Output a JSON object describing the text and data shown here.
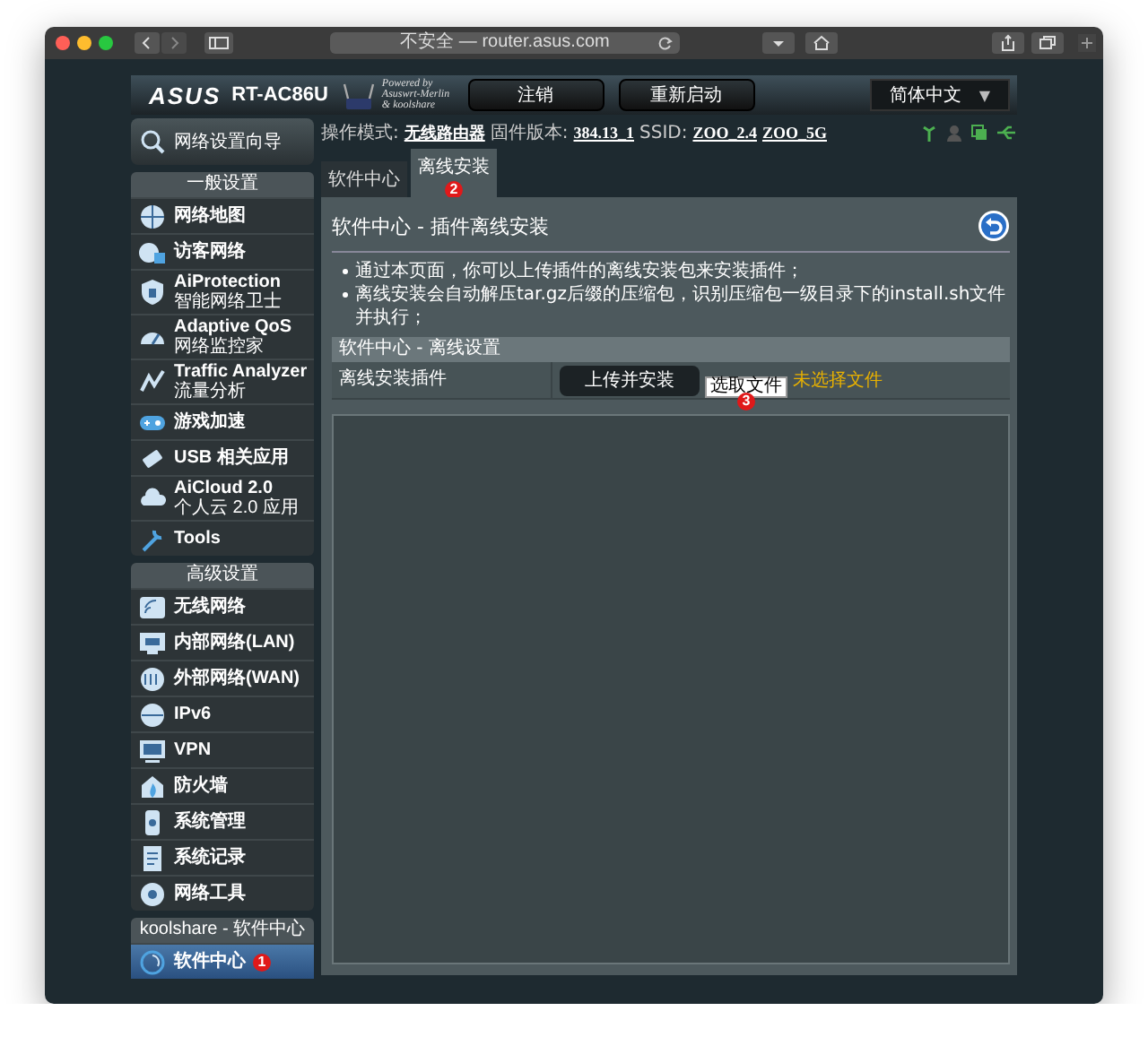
{
  "browser": {
    "url": "不安全 — router.asus.com"
  },
  "header": {
    "brand": "ASUS",
    "model": "RT-AC86U",
    "powered_by": [
      "Powered by",
      "Asuswrt-Merlin",
      "& koolshare"
    ],
    "buttons": [
      "注销",
      "重新启动"
    ],
    "language": "简体中文",
    "language_arrow": "▼"
  },
  "status_line": [
    {
      "kind": "label",
      "text": "操作模式:"
    },
    {
      "kind": "link",
      "text": "无线路由器"
    },
    {
      "kind": "label",
      "text": "固件版本:"
    },
    {
      "kind": "link",
      "text": "384.13_1"
    },
    {
      "kind": "label",
      "text": "SSID:"
    },
    {
      "kind": "link",
      "text": "ZOO_2.4"
    },
    {
      "kind": "link",
      "text": "ZOO_5G"
    }
  ],
  "sidebar": {
    "wizard": "网络设置向导",
    "sections": [
      {
        "title": "一般设置",
        "items": [
          {
            "label": "网络地图",
            "selected": false
          },
          {
            "label": "访客网络",
            "selected": false
          },
          {
            "label": "AiProtection",
            "sublabel": "智能网络卫士",
            "selected": false
          },
          {
            "label": "Adaptive QoS",
            "sublabel": "网络监控家",
            "selected": false
          },
          {
            "label": "Traffic Analyzer",
            "sublabel": "流量分析",
            "selected": false
          },
          {
            "label": "游戏加速",
            "selected": false
          },
          {
            "label": "USB 相关应用",
            "selected": false
          },
          {
            "label": "AiCloud 2.0",
            "sublabel": "个人云 2.0 应用",
            "selected": false
          },
          {
            "label": "Tools",
            "selected": false
          }
        ]
      },
      {
        "title": "高级设置",
        "items": [
          {
            "label": "无线网络",
            "selected": false
          },
          {
            "label": "内部网络(LAN)",
            "selected": false
          },
          {
            "label": "外部网络(WAN)",
            "selected": false
          },
          {
            "label": "IPv6",
            "selected": false
          },
          {
            "label": "VPN",
            "selected": false
          },
          {
            "label": "防火墙",
            "selected": false
          },
          {
            "label": "系统管理",
            "selected": false
          },
          {
            "label": "系统记录",
            "selected": false
          },
          {
            "label": "网络工具",
            "selected": false
          }
        ]
      },
      {
        "title": "koolshare - 软件中心",
        "items": [
          {
            "label": "软件中心",
            "selected": true,
            "marker": "1"
          }
        ]
      }
    ]
  },
  "tabs": [
    {
      "label": "软件中心",
      "selected": false
    },
    {
      "label": "离线安装",
      "selected": true,
      "marker": "2"
    }
  ],
  "panel": {
    "title": "软件中心 - 插件离线安装",
    "bullets": [
      "通过本页面，你可以上传插件的离线安装包来安装插件；",
      "离线安装会自动解压tar.gz后缀的压缩包，识别压缩包一级目录下的install.sh文件并执行；"
    ],
    "table": {
      "header": "软件中心 - 离线设置",
      "rows": [
        {
          "label": "离线安装插件",
          "button": "上传并安装",
          "file_button": "选取文件",
          "file_status": "未选择文件",
          "marker": "3"
        }
      ]
    }
  }
}
